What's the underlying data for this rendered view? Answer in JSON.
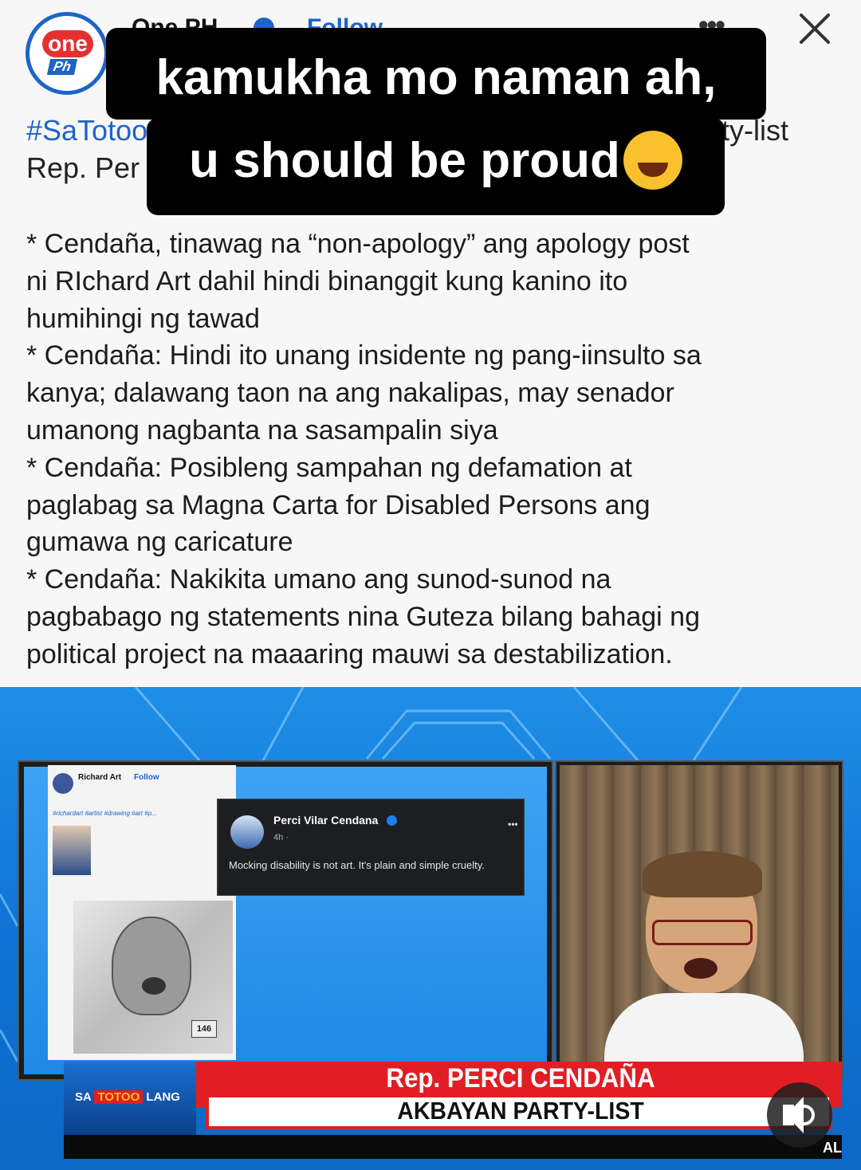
{
  "header": {
    "page_name": "One PH",
    "follow_label": "Follow",
    "logo_text_top": "one",
    "logo_text_bottom": "Ph"
  },
  "caption_overlay": {
    "line1": "kamukha mo naman ah,",
    "line2": "u should be proud"
  },
  "post": {
    "hashtag_partial": "#SaTotoo",
    "party_partial": "ty-list",
    "rep_partial": "Rep. Per",
    "lines": [
      "* Cendaña, tinawag na “non-apology” ang apology post",
      "ni RIchard Art dahil hindi binanggit kung kanino ito",
      "humihingi ng tawad",
      "* Cendaña: Hindi ito unang insidente ng pang-iinsulto sa",
      "kanya; dalawang taon na ang nakalipas, may senador",
      "umanong nagbanta na sasampalin siya",
      "* Cendaña: Posibleng sampahan ng defamation at",
      "paglabag sa Magna Carta for Disabled Persons ang",
      "gumawa ng caricature",
      "* Cendaña: Nakikita umano ang sunod-sunod na",
      "pagbabago ng statements nina Guteza bilang bahagi ng",
      "political project na maaaring mauwi sa destabilization."
    ]
  },
  "video": {
    "embedded_post": {
      "author": "Richard Art",
      "follow": "Follow",
      "tags": "#richardart #artist #drawing #art #p...",
      "badge": "146"
    },
    "quote_card": {
      "author": "Perci Vilar Cendana",
      "time": "4h · ",
      "text": "Mocking disability is not art. It's plain and simple cruelty."
    },
    "lower_third": {
      "title": "Rep. PERCI CENDAÑA",
      "subtitle": "AKBAYAN PARTY-LIST",
      "show_prefix": "SA",
      "show_mid": "TOTOO",
      "show_suffix": "LANG",
      "ticker": "AL"
    }
  },
  "colors": {
    "accent_blue": "#1d64c9",
    "lower_third_red": "#e11e23",
    "caption_bg": "#000000"
  },
  "icons": [
    "close-icon",
    "more-icon",
    "verified-icon",
    "sound-icon"
  ]
}
